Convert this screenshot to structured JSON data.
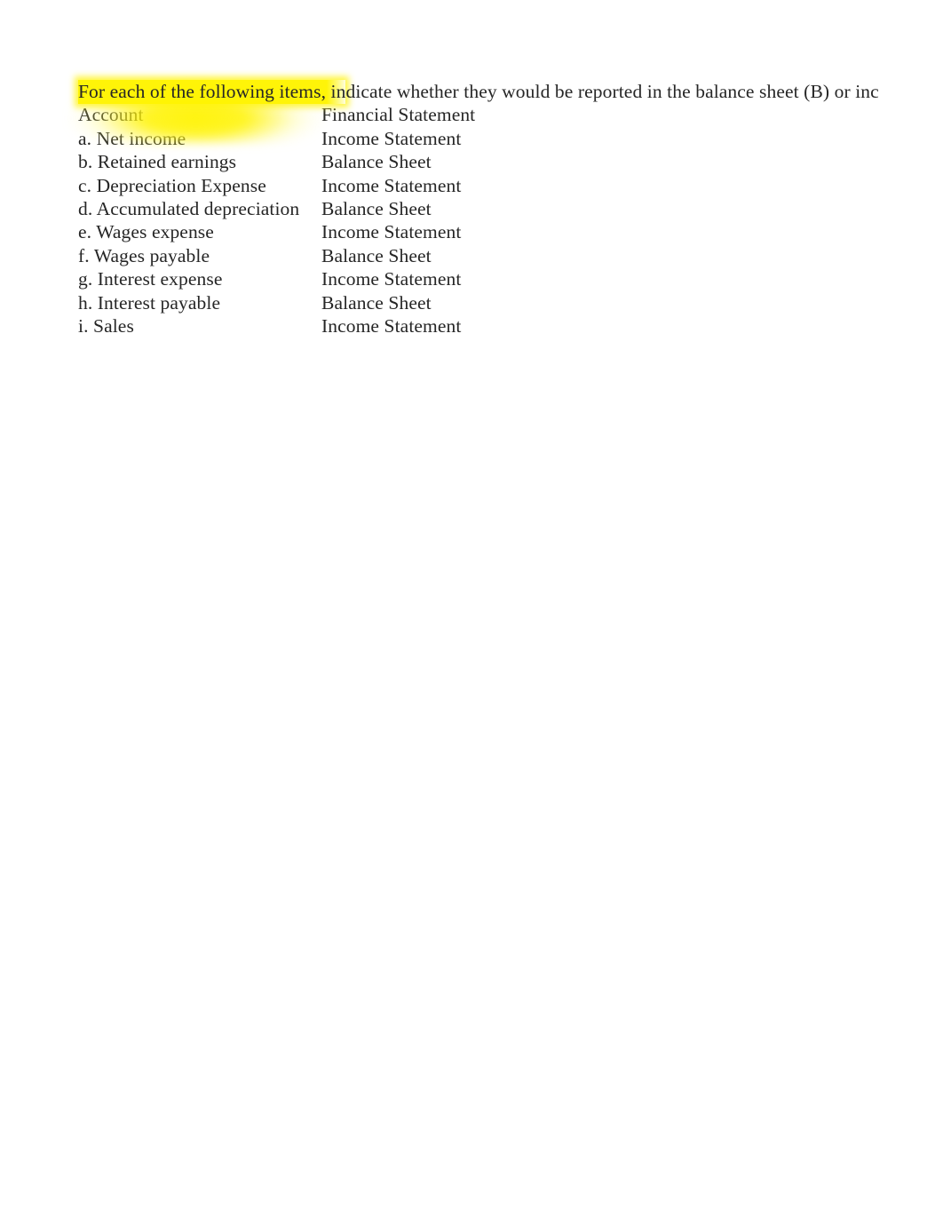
{
  "document": {
    "background_color": "#ffffff",
    "text_color": "#262626",
    "highlight_color": "#fff400",
    "prompt": {
      "highlighted_text": "For each of the following items, in",
      "remaining_text": "dicate whether they would be reported in the balance sheet (B) or inc"
    },
    "table": {
      "headers": {
        "account": "Account",
        "statement": "Financial Statement"
      },
      "rows": [
        {
          "account": "a. Net income",
          "statement": "Income Statement"
        },
        {
          "account": "b. Retained earnings",
          "statement": "Balance Sheet"
        },
        {
          "account": "c. Depreciation Expense",
          "statement": "Income Statement"
        },
        {
          "account": "d. Accumulated depreciation",
          "statement": "Balance Sheet"
        },
        {
          "account": "e. Wages expense",
          "statement": "Income Statement"
        },
        {
          "account": "f. Wages payable",
          "statement": "Balance Sheet"
        },
        {
          "account": "g. Interest expense",
          "statement": "Income Statement"
        },
        {
          "account": "h. Interest payable",
          "statement": "Balance Sheet"
        },
        {
          "account": "i. Sales",
          "statement": "Income Statement"
        }
      ]
    }
  }
}
